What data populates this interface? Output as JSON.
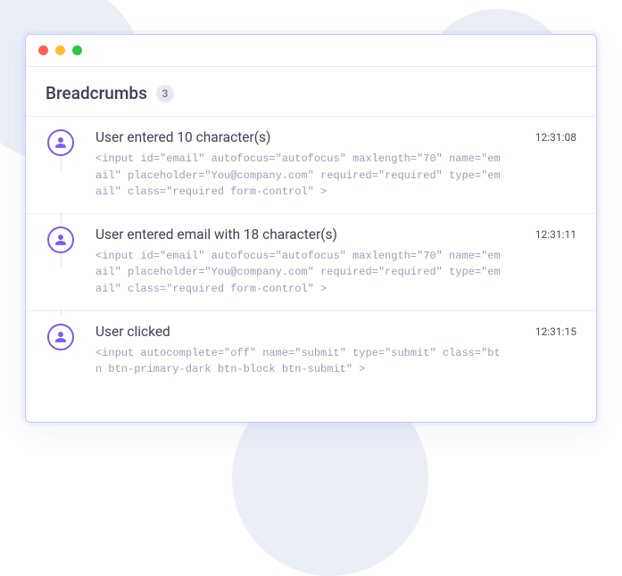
{
  "header": {
    "title": "Breadcrumbs",
    "count": "3"
  },
  "events": [
    {
      "title": "User entered 10 character(s)",
      "detail": "<input id=\"email\" autofocus=\"autofocus\" maxlength=\"70\" name=\"email\" placeholder=\"You@company.com\" required=\"required\" type=\"email\" class=\"required form-control\" >",
      "time": "12:31:08"
    },
    {
      "title": "User entered email with 18 character(s)",
      "detail": "<input id=\"email\" autofocus=\"autofocus\" maxlength=\"70\" name=\"email\" placeholder=\"You@company.com\" required=\"required\" type=\"email\" class=\"required form-control\" >",
      "time": "12:31:11"
    },
    {
      "title": "User clicked",
      "detail": "<input autocomplete=\"off\" name=\"submit\" type=\"submit\" class=\"btn btn-primary-dark btn-block btn-submit\" >",
      "time": "12:31:15"
    }
  ]
}
